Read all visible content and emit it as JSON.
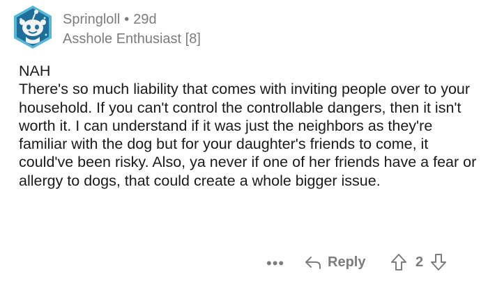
{
  "comment": {
    "author": "Springloll",
    "separator": "•",
    "age": "29d",
    "flair": "Asshole Enthusiast [8]",
    "verdict": "NAH",
    "body": "There's so much liability that comes with inviting people over to your household. If you can't control the controllable dangers, then it isn't worth it. I can understand if it was just the neighbors as they're familiar with the dog but for your daughter's friends to come, it could've been risky. Also, ya never if one of her friends have a fear or allergy to dogs, that could create a whole bigger issue.",
    "avatar_icon": "snoo-avatar-icon",
    "colors": {
      "avatar_bg": "#1d6e9b",
      "avatar_border": "#56b6d6",
      "meta_text": "#7c7c7c",
      "body_text": "#1a1a1b"
    }
  },
  "actions": {
    "more_label": "•••",
    "reply_label": "Reply",
    "score": "2",
    "upvote_icon": "upvote-arrow-icon",
    "downvote_icon": "downvote-arrow-icon",
    "reply_icon": "reply-arrow-icon"
  }
}
